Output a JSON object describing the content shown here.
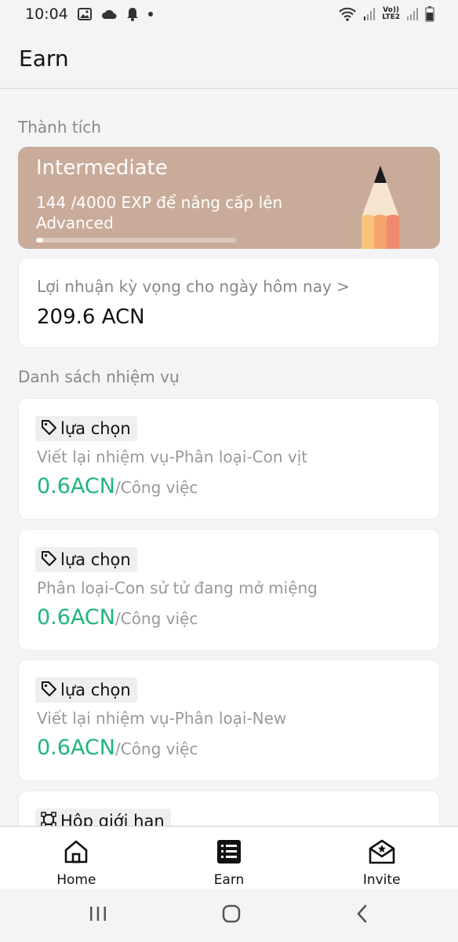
{
  "status_bar": {
    "time": "10:04",
    "lte_line1": "Vo))",
    "lte_line2": "LTE2",
    "icons": [
      "image-icon",
      "cloud-icon",
      "bell-icon",
      "dot-icon",
      "wifi-icon",
      "signal-icon",
      "signal-icon-2",
      "battery-icon"
    ]
  },
  "header": {
    "title": "Earn"
  },
  "achievement": {
    "section_title": "Thành tích",
    "level": "Intermediate",
    "exp_text": "144 /4000 EXP để nâng cấp lên Advanced",
    "progress": 0.036
  },
  "profit": {
    "label": "Lợi nhuận kỳ vọng cho ngày hôm nay >",
    "value": "209.6 ACN"
  },
  "tasks": {
    "section_title": "Danh sách nhiệm vụ",
    "items": [
      {
        "tag": "lựa chọn",
        "tag_icon": "tag-icon",
        "name": "Viết lại nhiệm vụ-Phân loại-Con vịt",
        "amount": "0.6ACN",
        "unit": "/Công việc"
      },
      {
        "tag": "lựa chọn",
        "tag_icon": "tag-icon",
        "name": "Phân loại-Con sử tử đang mở miệng",
        "amount": "0.6ACN",
        "unit": "/Công việc"
      },
      {
        "tag": "lựa chọn",
        "tag_icon": "tag-icon",
        "name": "Viết lại nhiệm vụ-Phân loại-New",
        "amount": "0.6ACN",
        "unit": "/Công việc"
      },
      {
        "tag": "Hộp giới hạn",
        "tag_icon": "bounding-box-icon",
        "name": "",
        "amount": "",
        "unit": ""
      }
    ]
  },
  "bottom_nav": {
    "items": [
      {
        "label": "Home",
        "icon": "home-icon"
      },
      {
        "label": "Earn",
        "icon": "list-icon"
      },
      {
        "label": "Invite",
        "icon": "invite-mail-icon"
      }
    ]
  },
  "system_nav": {
    "icons": [
      "recent-apps-icon",
      "home-circle-icon",
      "back-icon"
    ]
  },
  "colors": {
    "accent_green": "#20b57a",
    "level_card": "#c9ab99",
    "background": "#f4f4f6"
  }
}
